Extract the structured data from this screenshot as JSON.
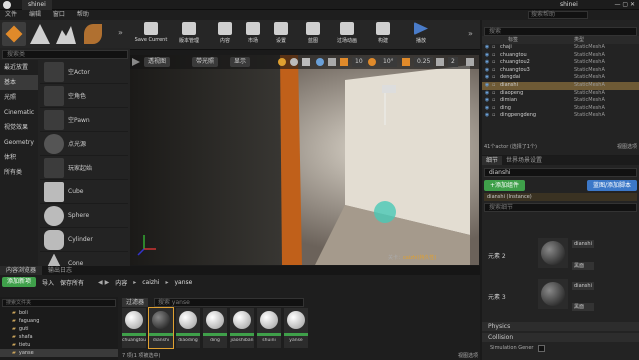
{
  "window": {
    "project_tab": "shinei",
    "user": "shinei"
  },
  "menu": [
    "文件",
    "编辑",
    "窗口",
    "帮助"
  ],
  "modes": {
    "search_placeholder": "搜索类"
  },
  "place_categories": [
    {
      "label": "最近放置"
    },
    {
      "label": "基本",
      "active": true
    },
    {
      "label": "光照"
    },
    {
      "label": "Cinematic"
    },
    {
      "label": "视觉效果"
    },
    {
      "label": "Geometry"
    },
    {
      "label": "体积"
    },
    {
      "label": "所有类"
    }
  ],
  "place_assets": [
    "空Actor",
    "空角色",
    "空Pawn",
    "点光源",
    "玩家起始",
    "Cube",
    "Sphere",
    "Cylinder",
    "Cone"
  ],
  "toolbar": [
    {
      "label": "Save Current"
    },
    {
      "label": "版本管理"
    },
    {
      "label": "内容"
    },
    {
      "label": "市场"
    },
    {
      "label": "设置"
    },
    {
      "label": "蓝图"
    },
    {
      "label": "过场动画"
    },
    {
      "label": "构建"
    },
    {
      "label": "播放"
    }
  ],
  "viewport": {
    "mode_perspective": "透视图",
    "mode_lit": "带光照",
    "mode_show": "显示",
    "grid_value": "10",
    "rot_value": "10°",
    "scale_value": "0.25",
    "cam_speed": "2",
    "level_label": "关卡：",
    "level_name": "caizhi(持久性)"
  },
  "outliner": {
    "search_placeholder": "搜索",
    "col_label": "标签",
    "col_type": "类型",
    "rows": [
      {
        "label": "chaji",
        "type": "StaticMeshA"
      },
      {
        "label": "chuangtou",
        "type": "StaticMeshA"
      },
      {
        "label": "chuangtou2",
        "type": "StaticMeshA"
      },
      {
        "label": "chuangtou3",
        "type": "StaticMeshA"
      },
      {
        "label": "dengdai",
        "type": "StaticMeshA"
      },
      {
        "label": "dianshi",
        "type": "StaticMeshA",
        "selected": true
      },
      {
        "label": "diaopeng",
        "type": "StaticMeshA"
      },
      {
        "label": "dimian",
        "type": "StaticMeshA"
      },
      {
        "label": "ding",
        "type": "StaticMeshA"
      },
      {
        "label": "dingpengdeng",
        "type": "StaticMeshA"
      }
    ],
    "footer_count": "41个actor (选择了1个)",
    "view_options": "视图选项"
  },
  "details": {
    "tab_details": "细节",
    "tab_world": "世界场景设置",
    "name_value": "dianshi",
    "add_component": "+添加组件",
    "blueprint_button": "蓝图/添加脚本",
    "instance_label": "dianshi (Instance)",
    "search_placeholder": "搜索细节",
    "element2_label": "元素 2",
    "element3_label": "元素 3",
    "mat2_name": "dianshi",
    "mat3_name": "dianshi",
    "mat_sub": "黑面",
    "physics": "Physics",
    "collision": "Collision",
    "sim_gen": "Simulation Gener"
  },
  "content_browser": {
    "tab_content": "内容浏览器",
    "tab_output": "输出日志",
    "add_new": "添加新项",
    "import": "导入",
    "save_all": "保存所有",
    "breadcrumb": [
      "内容",
      "caizhi",
      "yanse"
    ],
    "filter_label": "过滤器",
    "folder_search_placeholder": "搜索文件夹",
    "asset_search_placeholder": "搜索 yanse",
    "folders": [
      "boli",
      "faguang",
      "guti",
      "shafa",
      "tietu",
      "yanse"
    ],
    "assets": [
      "chuangtou",
      "dianshi",
      "diaoding",
      "ding",
      "jiaoshiban",
      "shuini",
      "yanse"
    ],
    "status": "7 项(1 项被选中)",
    "view_options": "视图选项"
  },
  "colors": {
    "accent": "#3c78c8",
    "selection": "#6e5a35",
    "green": "#3fa04a",
    "panel": "#232323"
  }
}
